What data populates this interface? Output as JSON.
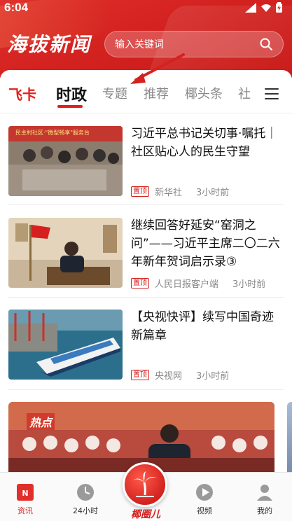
{
  "status_bar": {
    "time": "6:04"
  },
  "header": {
    "logo_text": "海拔新闻",
    "search_placeholder": "输入关键词"
  },
  "tabs": [
    {
      "label": "飞卡"
    },
    {
      "label": "时政"
    },
    {
      "label": "专题"
    },
    {
      "label": "推荐"
    },
    {
      "label": "椰头条"
    },
    {
      "label": "社"
    }
  ],
  "news": [
    {
      "title": "习近平总书记关切事·嘱托｜社区贴心人的民生守望",
      "badge": "置顶",
      "source": "新华社",
      "time": "3小时前",
      "thumb_text": "民主村社区·\"微型畅享\"服务台"
    },
    {
      "title": "继续回答好延安“窑洞之问”——习近平主席二〇二六年新年贺词启示录③",
      "badge": "置顶",
      "source": "人民日报客户端",
      "time": "3小时前"
    },
    {
      "title": "【央视快评】续写中国奇迹新篇章",
      "badge": "置顶",
      "source": "央视网",
      "time": "3小时前"
    }
  ],
  "big_card": {
    "tag": "热点"
  },
  "bottom_nav": [
    {
      "label": "资讯"
    },
    {
      "label": "24小时"
    },
    {
      "label": "椰圈儿"
    },
    {
      "label": "视频"
    },
    {
      "label": "我的"
    }
  ],
  "colors": {
    "brand_red": "#d3221f",
    "accent_red": "#e0201b"
  }
}
